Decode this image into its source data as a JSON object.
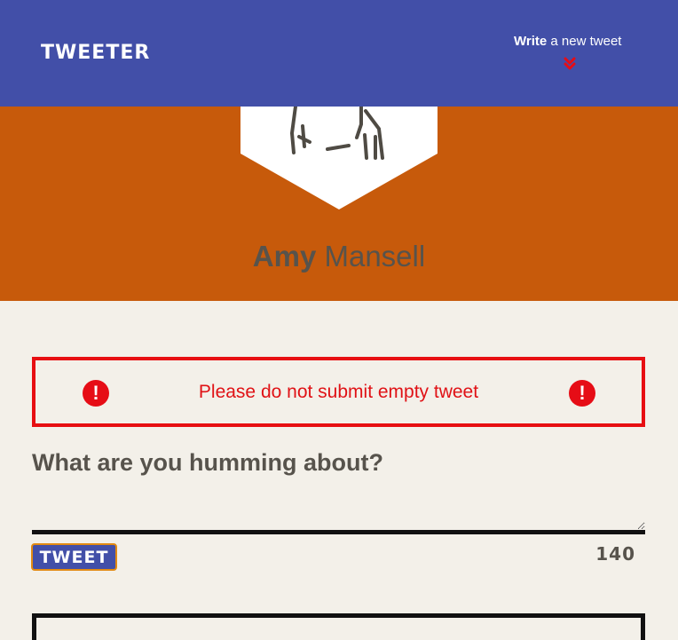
{
  "app": {
    "logo": "TWEETER"
  },
  "nav": {
    "write_bold": "Write",
    "write_rest": " a new tweet",
    "chevron_icon": "double-chevron-down",
    "chevron_color": "#e60d16"
  },
  "profile": {
    "first_name": "Amy",
    "last_name": "Mansell"
  },
  "error": {
    "message": "Please do not submit empty tweet",
    "icon_glyph": "!",
    "color": "#e70f12"
  },
  "composer": {
    "question": "What are you humming about?",
    "textarea_value": "",
    "tweet_button_label": "TWEET",
    "char_count": "140"
  },
  "colors": {
    "nav_bg": "#424fa8",
    "hero_bg": "#c75a0b",
    "page_bg": "#f3f0e9",
    "text_dark": "#57534c"
  }
}
